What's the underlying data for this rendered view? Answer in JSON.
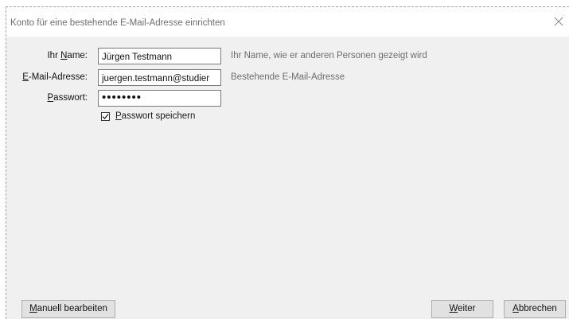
{
  "window": {
    "title": "Konto für eine bestehende E-Mail-Adresse einrichten",
    "close_icon": "close-icon"
  },
  "form": {
    "name": {
      "label_pre": "Ihr ",
      "label_mnemonic": "N",
      "label_post": "ame:",
      "value": "Jürgen Testmann",
      "hint": "Ihr Name, wie er anderen Personen gezeigt wird"
    },
    "email": {
      "label_mnemonic": "E",
      "label_post": "-Mail-Adresse:",
      "value": "juergen.testmann@studier",
      "hint": "Bestehende E-Mail-Adresse"
    },
    "password": {
      "label_mnemonic": "P",
      "label_post": "asswort:",
      "value": "••••••••"
    },
    "save_password": {
      "checked": true,
      "label_mnemonic": "P",
      "label_post": "asswort speichern"
    }
  },
  "buttons": {
    "manual": {
      "mnemonic": "M",
      "rest": "anuell bearbeiten"
    },
    "next": {
      "mnemonic": "W",
      "rest": "eiter"
    },
    "cancel": {
      "mnemonic": "A",
      "rest": "bbrechen"
    }
  }
}
